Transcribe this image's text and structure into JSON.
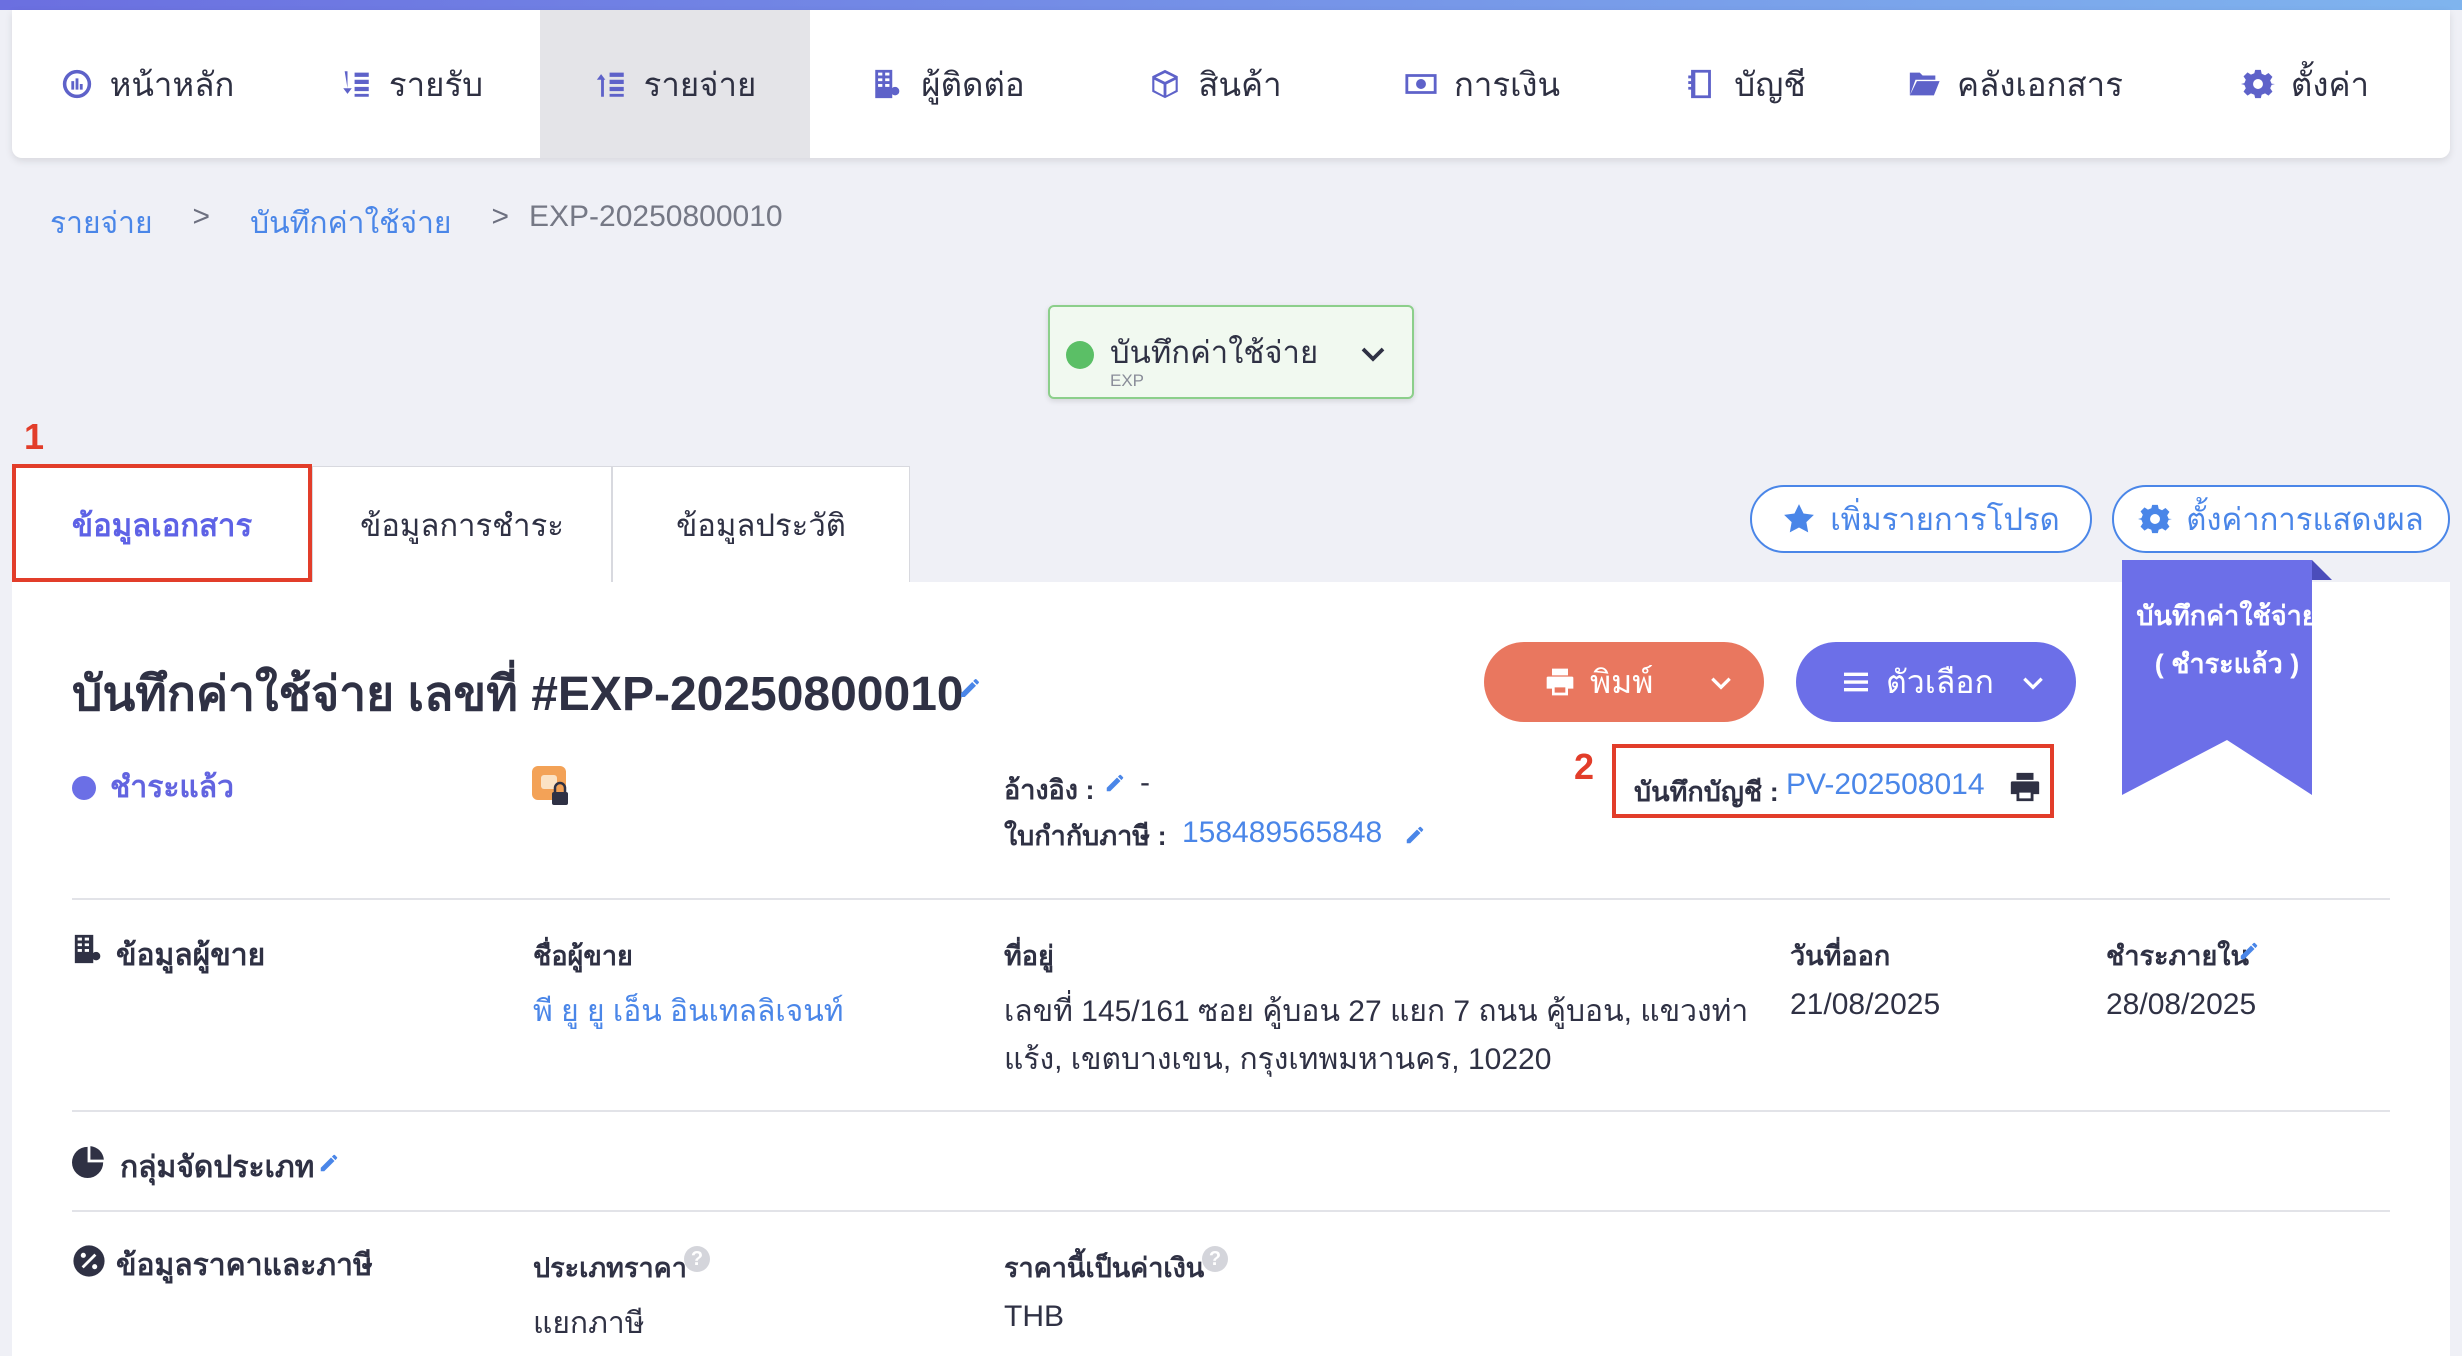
{
  "nav": [
    {
      "label": "หน้าหลัก",
      "icon": "dashboard-icon"
    },
    {
      "label": "รายรับ",
      "icon": "income-icon"
    },
    {
      "label": "รายจ่าย",
      "icon": "expense-icon",
      "active": true
    },
    {
      "label": "ผู้ติดต่อ",
      "icon": "contacts-icon"
    },
    {
      "label": "สินค้า",
      "icon": "box-icon"
    },
    {
      "label": "การเงิน",
      "icon": "money-icon"
    },
    {
      "label": "บัญชี",
      "icon": "book-icon"
    },
    {
      "label": "คลังเอกสาร",
      "icon": "folder-icon"
    },
    {
      "label": "ตั้งค่า",
      "icon": "gear-icon"
    }
  ],
  "breadcrumb": {
    "level1": "รายจ่าย",
    "sep": ">",
    "level2": "บันทึกค่าใช้จ่าย",
    "current": "EXP-20250800010"
  },
  "doc_type": {
    "name": "บันทึกค่าใช้จ่าย",
    "code": "EXP"
  },
  "annotations": {
    "one": "1",
    "two": "2"
  },
  "tabs": [
    "ข้อมูลเอกสาร",
    "ข้อมูลการชำระ",
    "ข้อมูลประวัติ"
  ],
  "actions": {
    "favorite": "เพิ่มรายการโปรด",
    "display_settings": "ตั้งค่าการแสดงผล"
  },
  "ribbon": {
    "line1": "บันทึกค่าใช้จ่าย",
    "line2": "( ชำระแล้ว )"
  },
  "document": {
    "title": "บันทึกค่าใช้จ่าย เลขที่ #EXP-20250800010",
    "print_label": "พิมพ์",
    "options_label": "ตัวเลือก",
    "status": "ชำระแล้ว",
    "reference_label": "อ้างอิง :",
    "reference_value": "-",
    "tax_invoice_label": "ใบกำกับภาษี :",
    "tax_invoice_value": "158489565848",
    "account_label": "บันทึกบัญชี :",
    "account_value": "PV-202508014"
  },
  "vendor": {
    "section_title": "ข้อมูลผู้ขาย",
    "name_label": "ชื่อผู้ขาย",
    "name_value": "พี ยู ยู เอ็น อินเทลลิเจนท์",
    "address_label": "ที่อยู่",
    "address_line1": "เลขที่ 145/161 ซอย คู้บอน 27 แยก 7 ถนน คู้บอน, แขวงท่า",
    "address_line2": "แร้ง, เขตบางเขน, กรุงเทพมหานคร, 10220",
    "issue_label": "วันที่ออก",
    "issue_value": "21/08/2025",
    "due_label": "ชำระภายใน",
    "due_value": "28/08/2025"
  },
  "category": {
    "section_title": "กลุ่มจัดประเภท"
  },
  "pricing": {
    "section_title": "ข้อมูลราคาและภาษี",
    "price_type_label": "ประเภทราคา",
    "price_type_value": "แยกภาษี",
    "currency_label": "ราคานี้เป็นค่าเงิน",
    "currency_value": "THB"
  },
  "colors": {
    "accent": "#6c6fe8",
    "link": "#4a86e8",
    "print": "#e9775f",
    "annotation": "#e23d2a"
  }
}
